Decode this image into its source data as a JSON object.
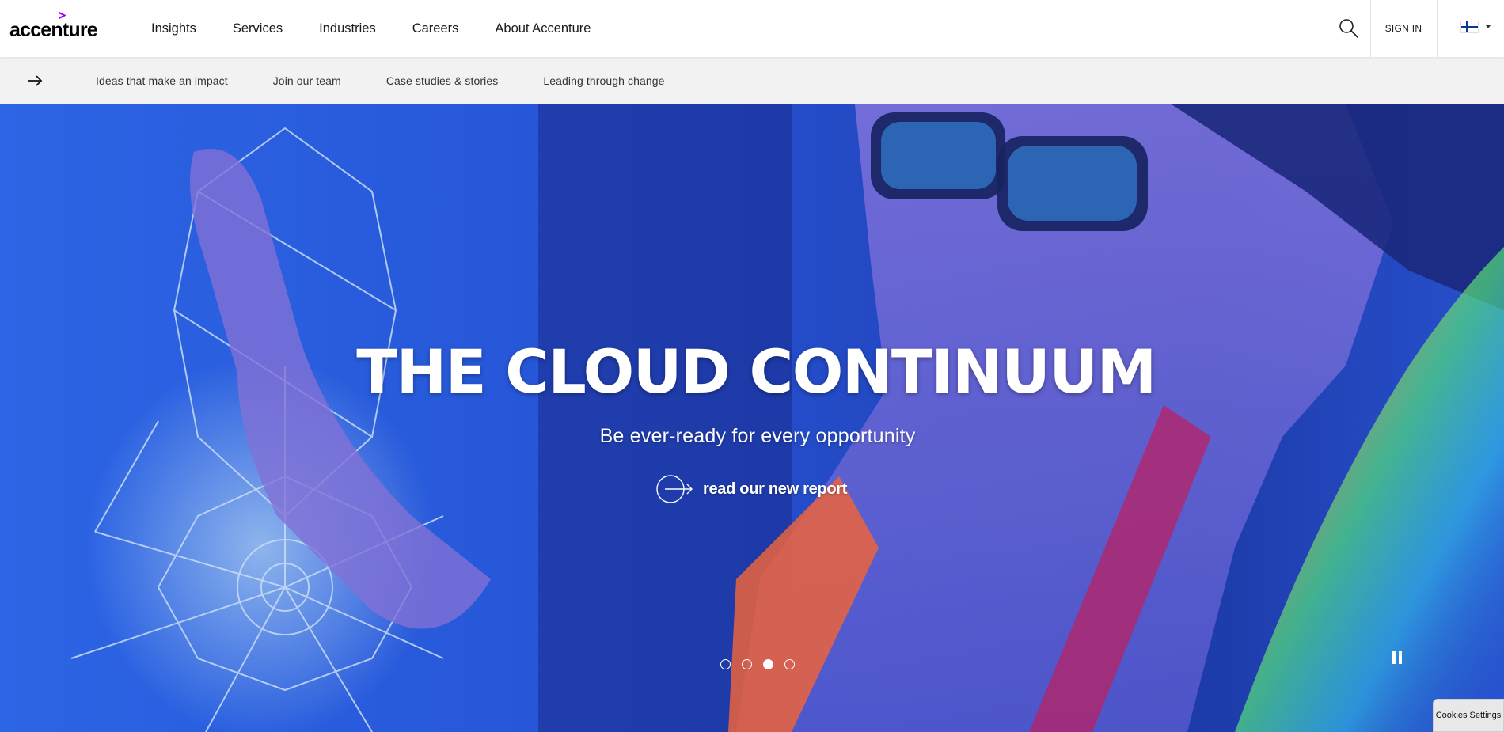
{
  "header": {
    "logo_text": "accenture",
    "nav": [
      {
        "label": "Insights"
      },
      {
        "label": "Services"
      },
      {
        "label": "Industries"
      },
      {
        "label": "Careers"
      },
      {
        "label": "About Accenture"
      }
    ],
    "search_icon": "search-icon",
    "signin_label": "SIGN IN",
    "country_flag": "finland-flag-icon"
  },
  "subnav": {
    "arrow_icon": "arrow-right-icon",
    "links": [
      {
        "label": "Ideas that make an impact"
      },
      {
        "label": "Join our team"
      },
      {
        "label": "Case studies & stories"
      },
      {
        "label": "Leading through change"
      }
    ]
  },
  "hero": {
    "headline": "THE CLOUD CONTINUUM",
    "subheadline": "Be ever-ready for every opportunity",
    "cta_label": "read our new report",
    "cta_icon": "circle-arrow-icon",
    "slides": 4,
    "active_slide": 3,
    "pause_icon": "pause-icon"
  },
  "cookies_label": "Cookies Settings",
  "colors": {
    "brand_accent": "#a100ff",
    "hero_blue": "#2a63e6",
    "subbar_bg": "#f2f2f2"
  }
}
